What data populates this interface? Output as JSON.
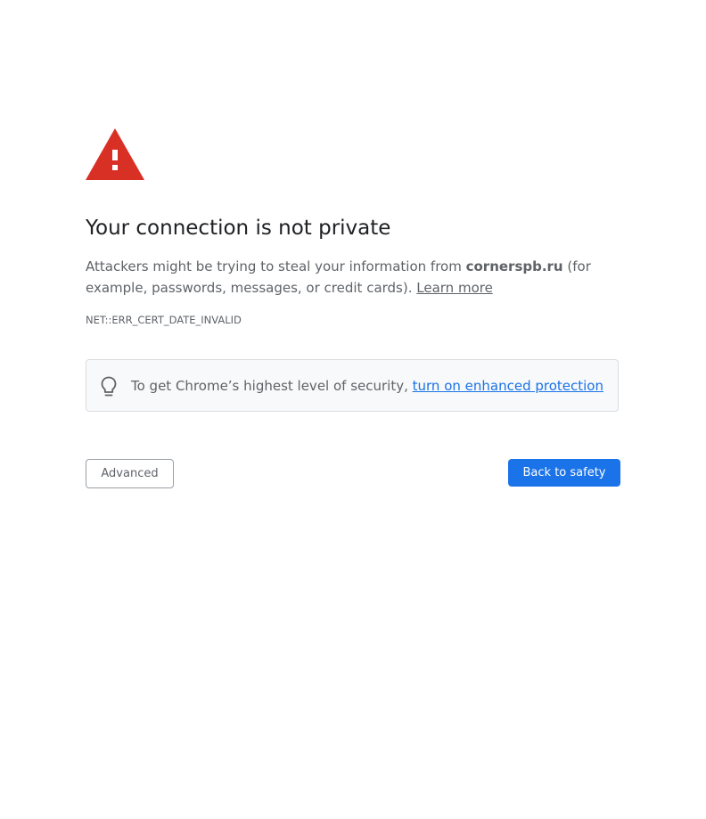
{
  "page": {
    "title": "Your connection is not private",
    "message_prefix": "Attackers might be trying to steal your information from ",
    "domain": "cornerspb.ru",
    "message_suffix": " (for example, passwords, messages, or credit cards). ",
    "learn_more": "Learn more",
    "error_code": "NET::ERR_CERT_DATE_INVALID"
  },
  "enhanced_protection": {
    "prefix": "To get Chrome’s highest level of security, ",
    "link": "turn on enhanced protection"
  },
  "buttons": {
    "advanced": "Advanced",
    "back_to_safety": "Back to safety"
  },
  "icons": {
    "warning": "warning-triangle-icon",
    "bulb": "lightbulb-icon"
  },
  "colors": {
    "warning_red": "#d93025",
    "link_blue": "#1a73e8",
    "text_gray": "#5f6368",
    "title": "#202124"
  }
}
